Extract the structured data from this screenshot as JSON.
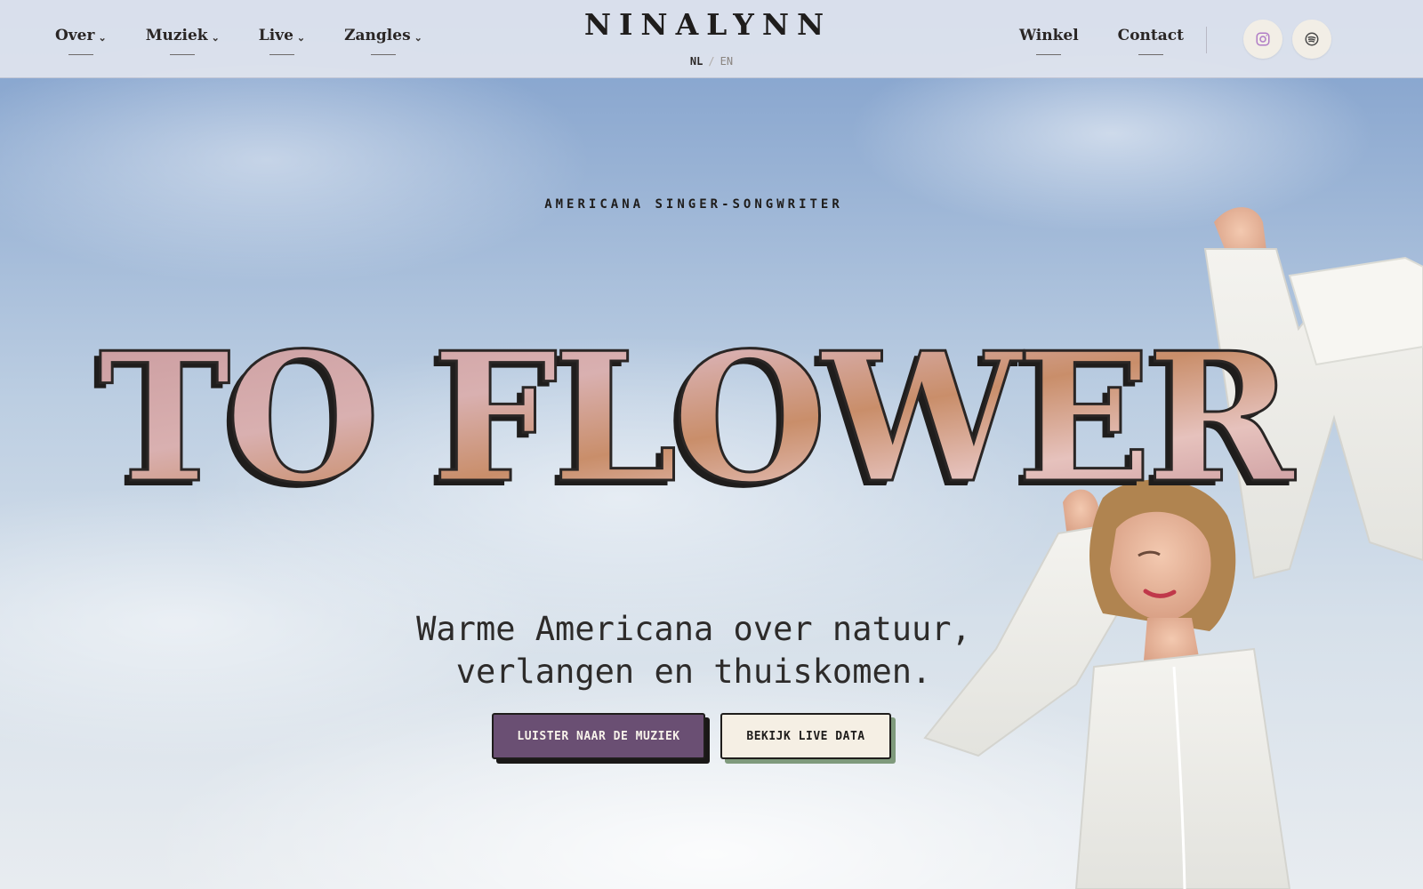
{
  "header": {
    "logo": "NINALYNN",
    "nav_left": [
      {
        "label": "Over",
        "chevron": "⌄"
      },
      {
        "label": "Muziek",
        "chevron": "⌄"
      },
      {
        "label": "Live",
        "chevron": "⌄"
      },
      {
        "label": "Zangles",
        "chevron": "⌄"
      }
    ],
    "language": {
      "active": "NL",
      "separator": "/",
      "other": "EN"
    },
    "nav_right": [
      {
        "label": "Winkel"
      },
      {
        "label": "Contact"
      }
    ],
    "social": [
      {
        "icon": "instagram-icon",
        "color": "#b07cc6"
      },
      {
        "icon": "spotify-icon",
        "color": "#5a5a5a"
      }
    ]
  },
  "hero": {
    "eyebrow": "AMERICANA SINGER-SONGWRITER",
    "title": "TO FLOWER",
    "subtitle_line1": "Warme Americana over natuur,",
    "subtitle_line2": "verlangen en thuiskomen.",
    "primary_button": "LUISTER NAAR DE MUZIEK",
    "secondary_button": "BEKIJK LIVE DATA"
  },
  "colors": {
    "primary_button": "#6a4f73",
    "secondary_button": "#f5efe4",
    "secondary_shadow": "#7f9a7c",
    "title_fill": "#c99a9e"
  }
}
